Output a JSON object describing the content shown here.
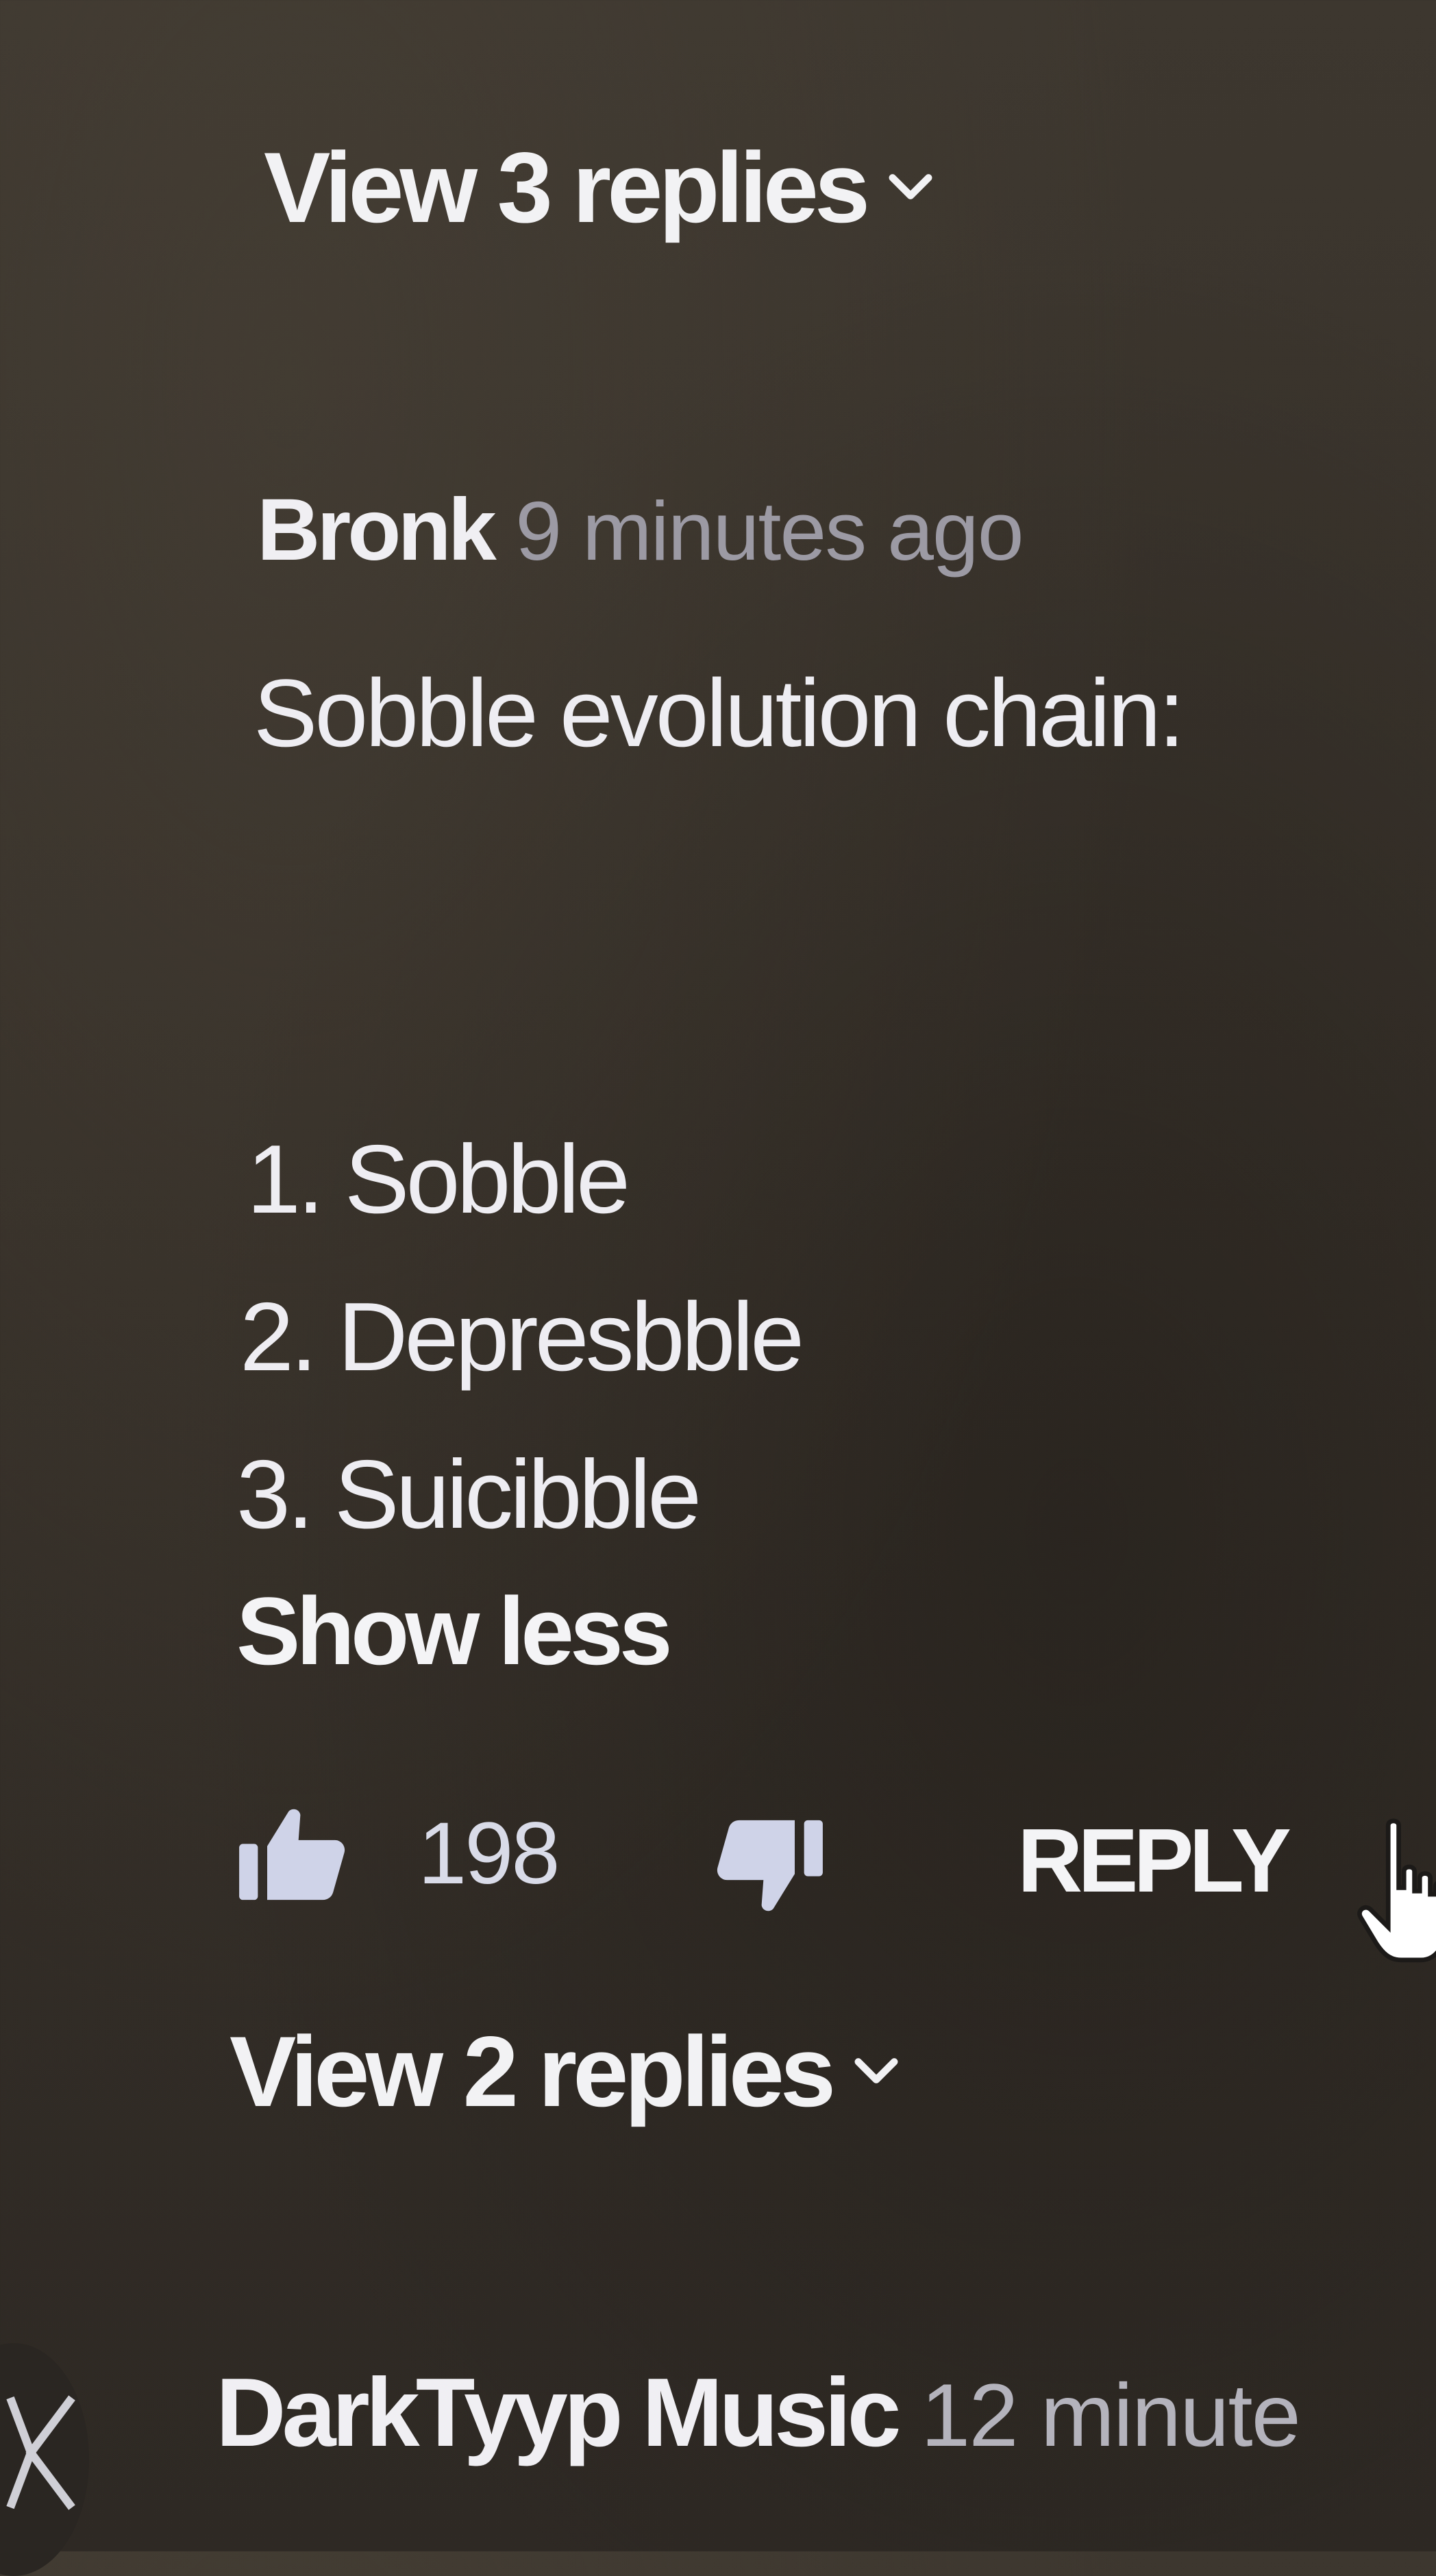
{
  "thread": {
    "view_replies_top": "View 3 replies",
    "view_replies_bottom": "View 2 replies"
  },
  "comment": {
    "author": "Bronk",
    "timestamp": "9 minutes ago",
    "body_intro": "Sobble evolution chain:",
    "list": [
      "1. Sobble",
      "2. Depresbble",
      "3. Suicibble"
    ],
    "show_less": "Show less",
    "like_count": "198",
    "reply_label": "REPLY"
  },
  "next_comment": {
    "author": "DarkTyyp Music",
    "timestamp": "12 minute"
  },
  "icons": {
    "like": "thumbs-up-icon",
    "dislike": "thumbs-down-icon",
    "chevron": "chevron-down-icon",
    "cursor": "hand-pointer-icon"
  },
  "colors": {
    "background": "#3a342c",
    "text_primary": "#eeedf2",
    "text_secondary": "#9c9aa4",
    "icon_tint": "#cfd3e8"
  }
}
